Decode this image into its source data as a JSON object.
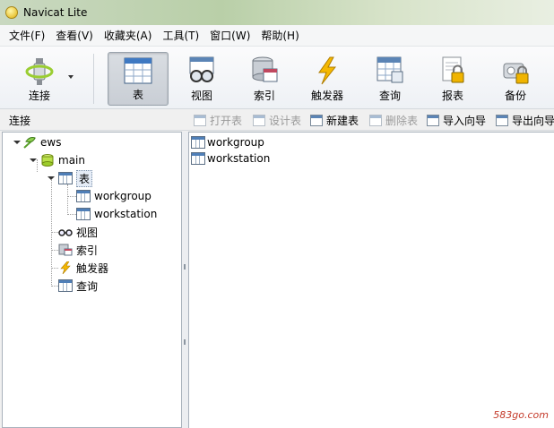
{
  "window": {
    "title": "Navicat Lite"
  },
  "menu": [
    {
      "label": "文件(F)"
    },
    {
      "label": "查看(V)"
    },
    {
      "label": "收藏夹(A)"
    },
    {
      "label": "工具(T)"
    },
    {
      "label": "窗口(W)"
    },
    {
      "label": "帮助(H)"
    }
  ],
  "toolbar": {
    "connect": "连接",
    "table": "表",
    "view": "视图",
    "index": "索引",
    "trigger": "触发器",
    "query": "查询",
    "report": "报表",
    "backup": "备份"
  },
  "subbar": {
    "label": "连接",
    "open_table": "打开表",
    "design_table": "设计表",
    "new_table": "新建表",
    "delete_table": "删除表",
    "import_wizard": "导入向导",
    "export_wizard": "导出向导"
  },
  "tree": {
    "connection": "ews",
    "database": "main",
    "tables_folder": "表",
    "tables": [
      "workgroup",
      "workstation"
    ],
    "views_folder": "视图",
    "indexes_folder": "索引",
    "triggers_folder": "触发器",
    "queries_folder": "查询"
  },
  "objects": [
    "workgroup",
    "workstation"
  ],
  "watermark": "583go.com"
}
